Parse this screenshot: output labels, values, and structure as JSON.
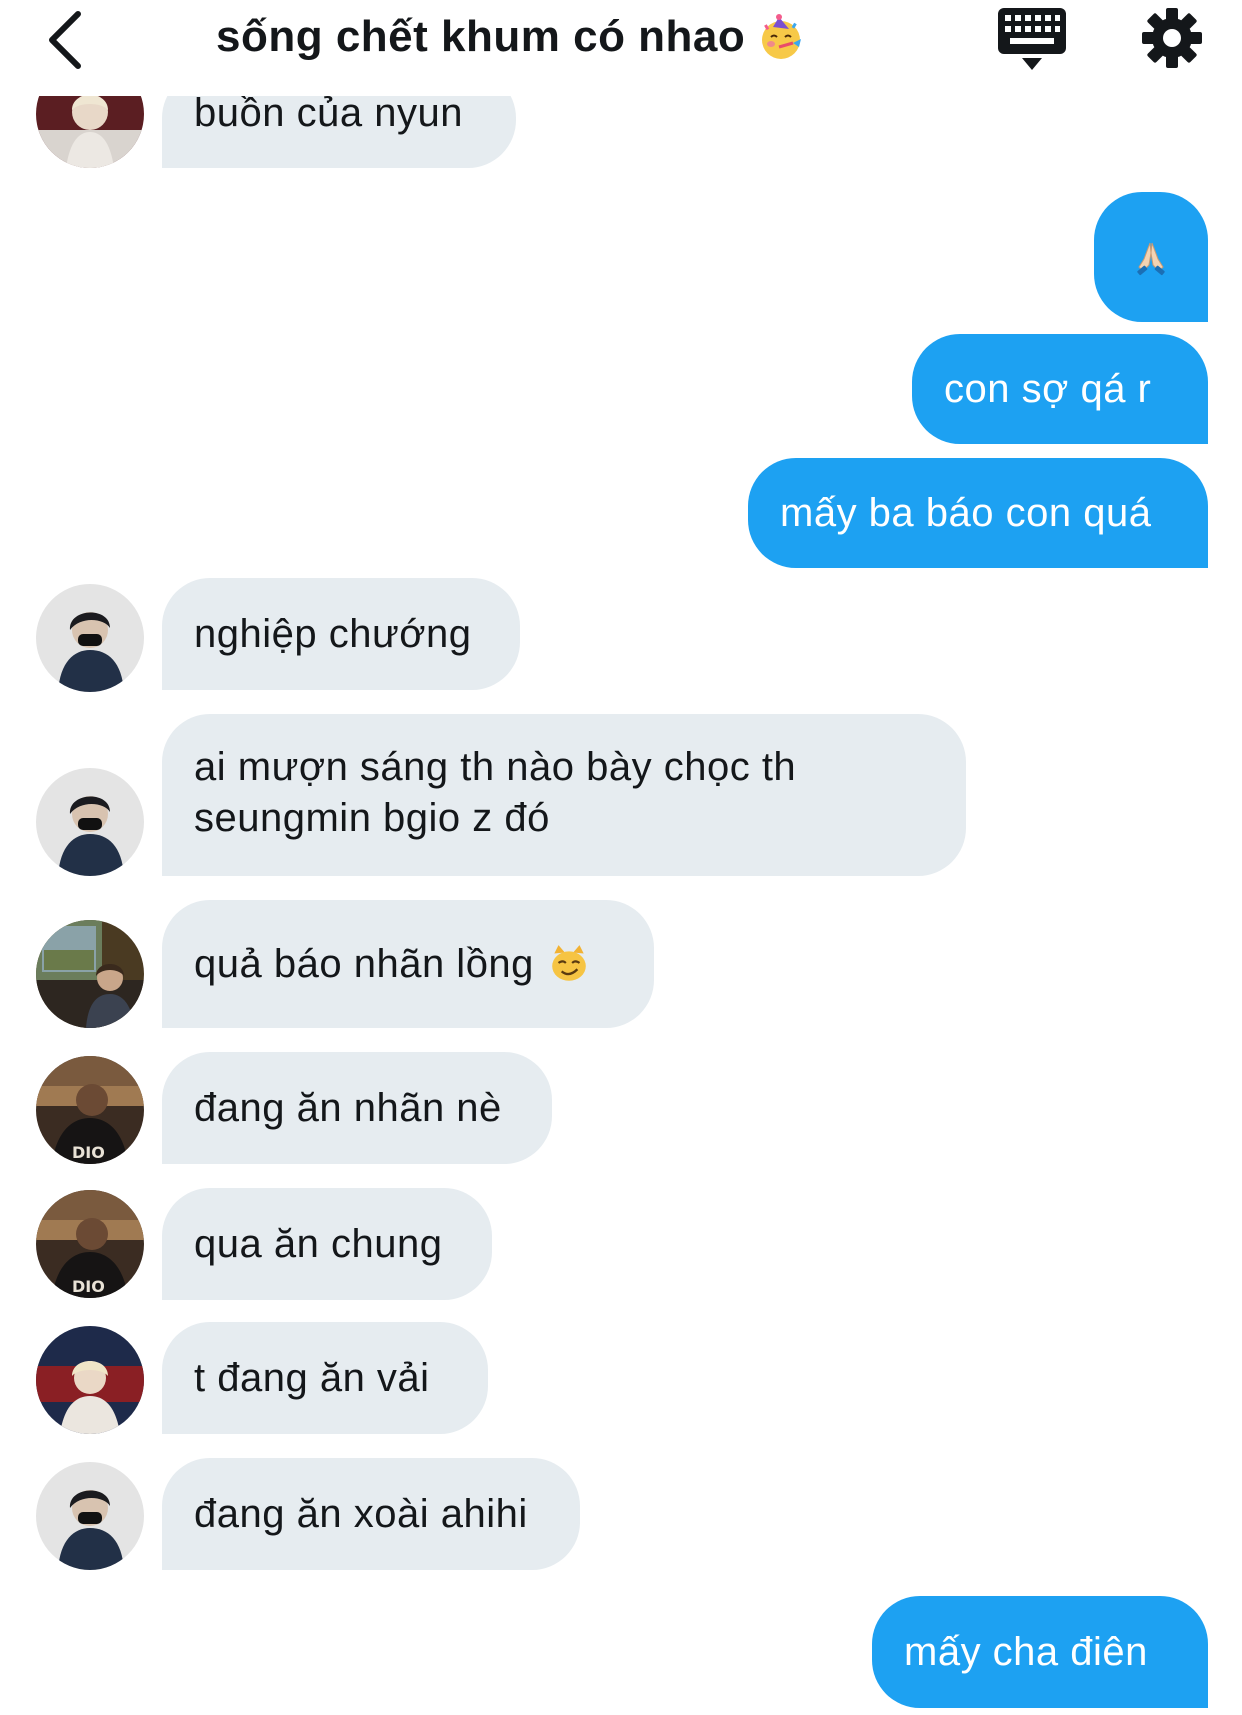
{
  "header": {
    "title": "sống chết khum có nhao",
    "title_emoji": "partying-face-emoji",
    "back_icon": "chevron-left-icon",
    "keyboard_icon": "keyboard-icon",
    "settings_icon": "gear-icon"
  },
  "colors": {
    "outgoing_bubble": "#1da1f2",
    "incoming_bubble": "#e6ecf0",
    "text_dark": "#14171a"
  },
  "messages": [
    {
      "direction": "in",
      "text": "buồn của nyun",
      "avatar": "avatar-user-c"
    },
    {
      "direction": "out",
      "text": "🙏",
      "emoji": "folded-hands-emoji"
    },
    {
      "direction": "out",
      "text": "con sợ qá r"
    },
    {
      "direction": "out",
      "text": "mấy ba báo con quá"
    },
    {
      "direction": "in",
      "text": "nghiệp chướng",
      "avatar": "avatar-user-a"
    },
    {
      "direction": "in",
      "text": "ai mượn sáng th nào bày chọc th seungmin bgio z đó",
      "avatar": "avatar-user-a"
    },
    {
      "direction": "in",
      "text": "quả báo nhãn lồng",
      "emoji": "smirking-cat-emoji",
      "avatar": "avatar-user-b"
    },
    {
      "direction": "in",
      "text": "đang ăn nhãn nè",
      "avatar": "avatar-user-d"
    },
    {
      "direction": "in",
      "text": "qua ăn chung",
      "avatar": "avatar-user-d"
    },
    {
      "direction": "in",
      "text": "t đang ăn vải",
      "avatar": "avatar-user-c"
    },
    {
      "direction": "in",
      "text": "đang ăn xoài ahihi",
      "avatar": "avatar-user-a"
    },
    {
      "direction": "out",
      "text": "mấy cha điên"
    }
  ]
}
